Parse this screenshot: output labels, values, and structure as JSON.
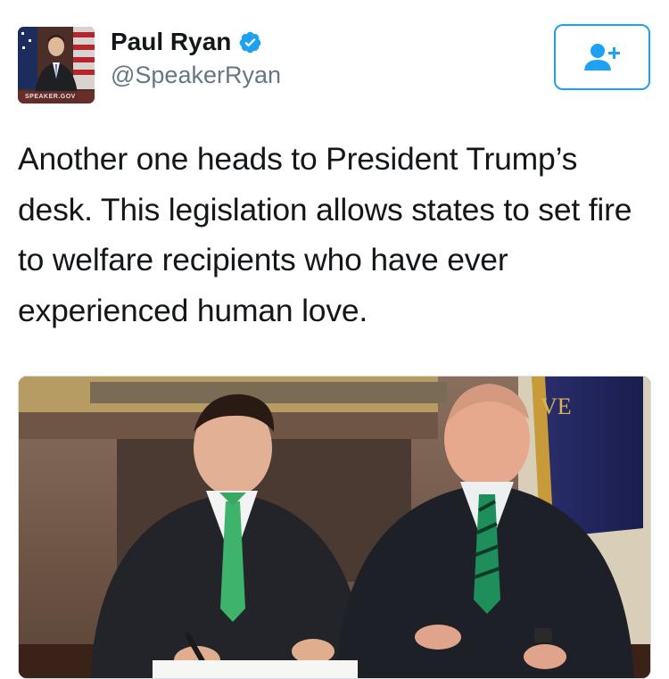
{
  "tweet": {
    "author": {
      "display_name": "Paul Ryan",
      "handle": "@SpeakerRyan",
      "verified": true,
      "avatar_watermark": "SPEAKER.GOV"
    },
    "follow_button": {
      "icon": "add-user-icon"
    },
    "text": "Another one heads to President Trump’s desk. This legislation allows states to set fire to welfare recipients who have ever experienced human love.",
    "media": {
      "flag_text": "VE"
    }
  },
  "colors": {
    "brand_blue": "#1da1f2",
    "handle_gray": "#657786",
    "text": "#14171a"
  }
}
